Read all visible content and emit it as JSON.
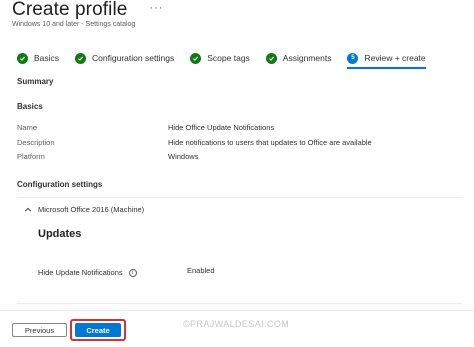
{
  "header": {
    "title": "Create profile",
    "more": "···",
    "subtitle": "Windows 10 and later - Settings catalog"
  },
  "steps": [
    {
      "label": "Basics",
      "state": "done"
    },
    {
      "label": "Configuration settings",
      "state": "done"
    },
    {
      "label": "Scope tags",
      "state": "done"
    },
    {
      "label": "Assignments",
      "state": "done"
    },
    {
      "label": "Review + create",
      "state": "active",
      "number": "5"
    }
  ],
  "summary": {
    "heading": "Summary",
    "basics_heading": "Basics",
    "rows": [
      {
        "label": "Name",
        "value": "Hide Office Update Notifications"
      },
      {
        "label": "Description",
        "value": "Hide notifications to users that updates to Office are available"
      },
      {
        "label": "Platform",
        "value": "Windows"
      }
    ],
    "config_heading": "Configuration settings",
    "category": "Microsoft Office 2016 (Machine)",
    "subcategory": "Updates",
    "setting": {
      "label": "Hide Update Notifications",
      "value": "Enabled"
    }
  },
  "footer": {
    "previous_label": "Previous",
    "create_label": "Create",
    "watermark": "©PRAJWALDESAI.COM"
  },
  "colors": {
    "accent": "#0078d4",
    "success": "#107c10",
    "highlight": "#d13438"
  }
}
